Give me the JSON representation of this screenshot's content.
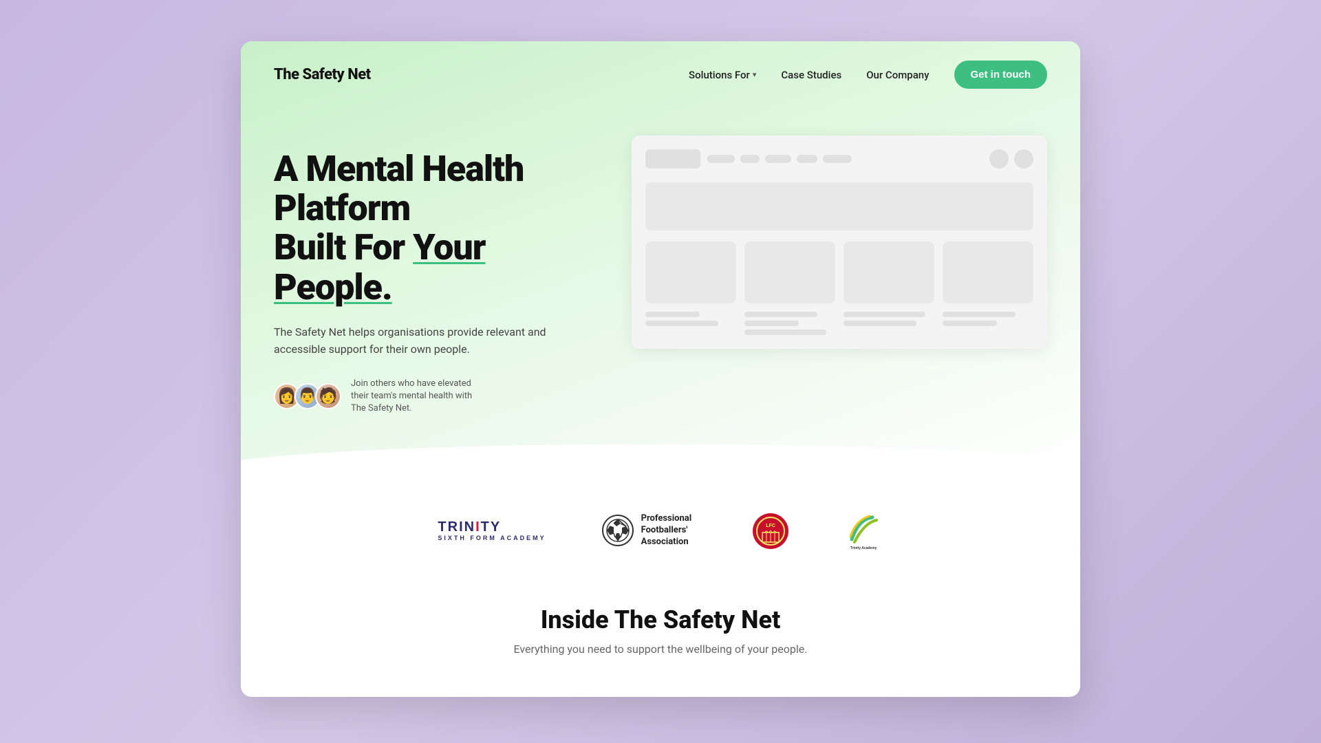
{
  "brand": {
    "logo": "The Safety Net"
  },
  "navbar": {
    "links": [
      {
        "label": "Solutions For",
        "hasDropdown": true
      },
      {
        "label": "Case Studies",
        "hasDropdown": false
      },
      {
        "label": "Our Company",
        "hasDropdown": false
      }
    ],
    "cta": "Get in touch"
  },
  "hero": {
    "heading_part1": "A Mental Health Platform",
    "heading_part2": "Built For ",
    "heading_highlight": "Your People.",
    "subtext": "The Safety Net helps organisations provide relevant and accessible support for their own people.",
    "social_proof_text": "Join others who have elevated their team's mental health with The Safety Net."
  },
  "logos": [
    {
      "name": "Trinity Sixth Form Academy",
      "type": "trinity"
    },
    {
      "name": "Professional Footballers' Association",
      "type": "pfa"
    },
    {
      "name": "Liverpool FC",
      "type": "lfc"
    },
    {
      "name": "Trinity Academy Halifax",
      "type": "tah"
    }
  ],
  "inside": {
    "title": "Inside The Safety Net",
    "subtitle": "Everything you need to support the wellbeing of your people."
  }
}
